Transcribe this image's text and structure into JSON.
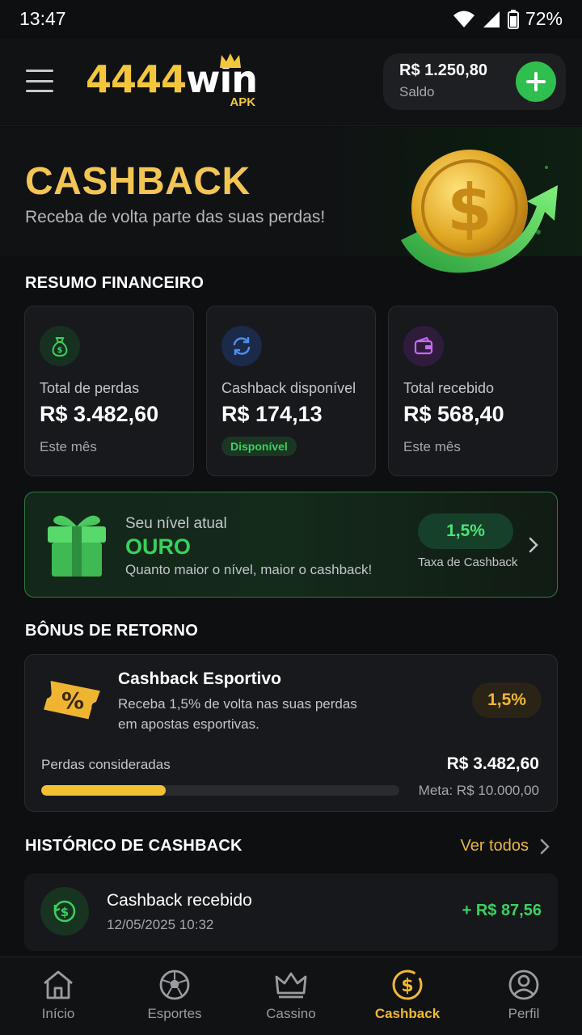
{
  "status_bar": {
    "time": "13:47",
    "battery": "72%"
  },
  "header": {
    "logo_main": "4444",
    "logo_win": "win",
    "logo_sub": "APK",
    "balance_amount": "R$ 1.250,80",
    "balance_label": "Saldo"
  },
  "hero": {
    "title": "CASHBACK",
    "subtitle": "Receba de volta parte das suas perdas!"
  },
  "summary": {
    "title": "RESUMO FINANCEIRO",
    "cards": [
      {
        "label": "Total de perdas",
        "value": "R$ 3.482,60",
        "sub": "Este mês",
        "icon": "money-bag-icon"
      },
      {
        "label": "Cashback disponível",
        "value": "R$ 174,13",
        "badge": "Disponível",
        "icon": "refresh-icon"
      },
      {
        "label": "Total recebido",
        "value": "R$ 568,40",
        "sub": "Este mês",
        "icon": "wallet-icon"
      }
    ]
  },
  "level": {
    "label": "Seu nível atual",
    "name": "OURO",
    "description": "Quanto maior o nível, maior o cashback!",
    "rate": "1,5%",
    "rate_label": "Taxa de Cashback"
  },
  "bonus": {
    "section_title": "BÔNUS DE RETORNO",
    "title": "Cashback Esportivo",
    "description": "Receba 1,5% de volta nas suas perdas em apostas esportivas.",
    "rate": "1,5%",
    "progress_label": "Perdas consideradas",
    "progress_value": "R$ 3.482,60",
    "progress_fraction": 0.3483,
    "goal": "Meta: R$ 10.000,00"
  },
  "history": {
    "title": "HISTÓRICO DE CASHBACK",
    "see_all": "Ver todos",
    "items": [
      {
        "title": "Cashback recebido",
        "date": "12/05/2025 10:32",
        "amount": "+ R$ 87,56"
      }
    ]
  },
  "nav": {
    "items": [
      {
        "label": "Início",
        "icon": "home-icon"
      },
      {
        "label": "Esportes",
        "icon": "soccer-ball-icon"
      },
      {
        "label": "Cassino",
        "icon": "crown-icon"
      },
      {
        "label": "Cashback",
        "icon": "cashback-coin-icon",
        "active": true
      },
      {
        "label": "Perfil",
        "icon": "profile-icon"
      }
    ]
  },
  "colors": {
    "gold": "#f3c552",
    "green": "#3bd160",
    "background": "#0e0f11"
  }
}
